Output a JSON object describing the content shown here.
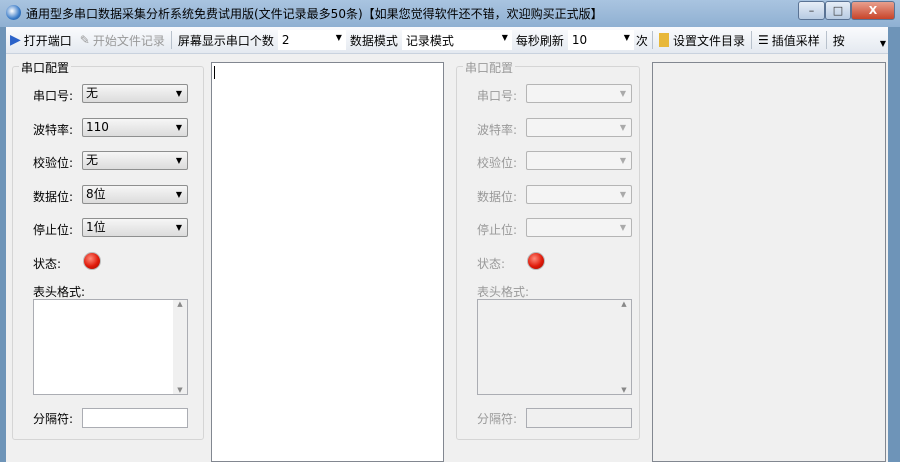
{
  "window": {
    "title": "通用型多串口数据采集分析系统免费试用版(文件记录最多50条)【如果您觉得软件还不错，欢迎购买正式版】",
    "minimize": "–",
    "maximize": "□",
    "close": "X"
  },
  "toolbar": {
    "open_port": "打开端口",
    "start_record": "开始文件记录",
    "screen_ports_label": "屏幕显示串口个数",
    "screen_ports_value": "2",
    "data_mode_label": "数据模式",
    "data_mode_value": "记录模式",
    "refresh_label": "每秒刷新",
    "refresh_value": "10",
    "refresh_unit": "次",
    "set_dir": "设置文件目录",
    "interp": "插值采样",
    "more": "按"
  },
  "left_panel": {
    "group_title": "串口配置",
    "port_label": "串口号:",
    "port_value": "无",
    "baud_label": "波特率:",
    "baud_value": "110",
    "parity_label": "校验位:",
    "parity_value": "无",
    "databits_label": "数据位:",
    "databits_value": "8位",
    "stopbits_label": "停止位:",
    "stopbits_value": "1位",
    "status_label": "状态:",
    "header_label": "表头格式:",
    "separator_label": "分隔符:"
  },
  "right_panel": {
    "group_title": "串口配置",
    "port_label": "串口号:",
    "baud_label": "波特率:",
    "parity_label": "校验位:",
    "databits_label": "数据位:",
    "stopbits_label": "停止位:",
    "status_label": "状态:",
    "header_label": "表头格式:",
    "separator_label": "分隔符:"
  },
  "colors": {
    "led": "#e01a0a",
    "titlebar": "#a9c4e0"
  }
}
